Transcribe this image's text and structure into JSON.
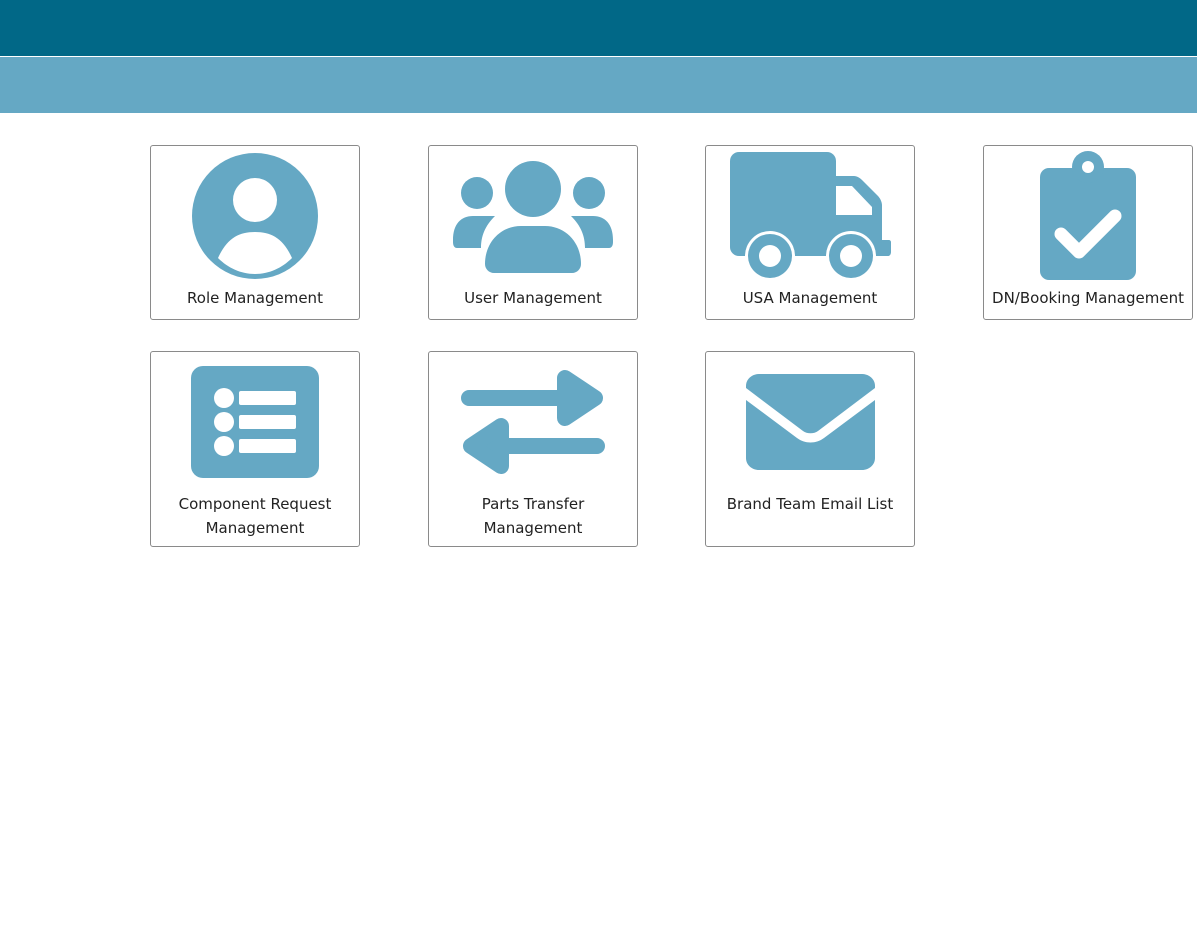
{
  "header": {
    "brand_color": "#016887",
    "subbar_color": "#65a8c4"
  },
  "icon_color": "#65a8c4",
  "tiles": [
    {
      "label": "Role Management",
      "icon": "user-circle-icon"
    },
    {
      "label": "User Management",
      "icon": "users-icon"
    },
    {
      "label": "USA Management",
      "icon": "truck-icon"
    },
    {
      "label": "DN/Booking Management",
      "icon": "clipboard-check-icon"
    },
    {
      "label": "Component Request Management",
      "icon": "list-icon"
    },
    {
      "label": "Parts Transfer Management",
      "icon": "exchange-arrows-icon"
    },
    {
      "label": "Brand Team Email List",
      "icon": "envelope-icon"
    }
  ]
}
